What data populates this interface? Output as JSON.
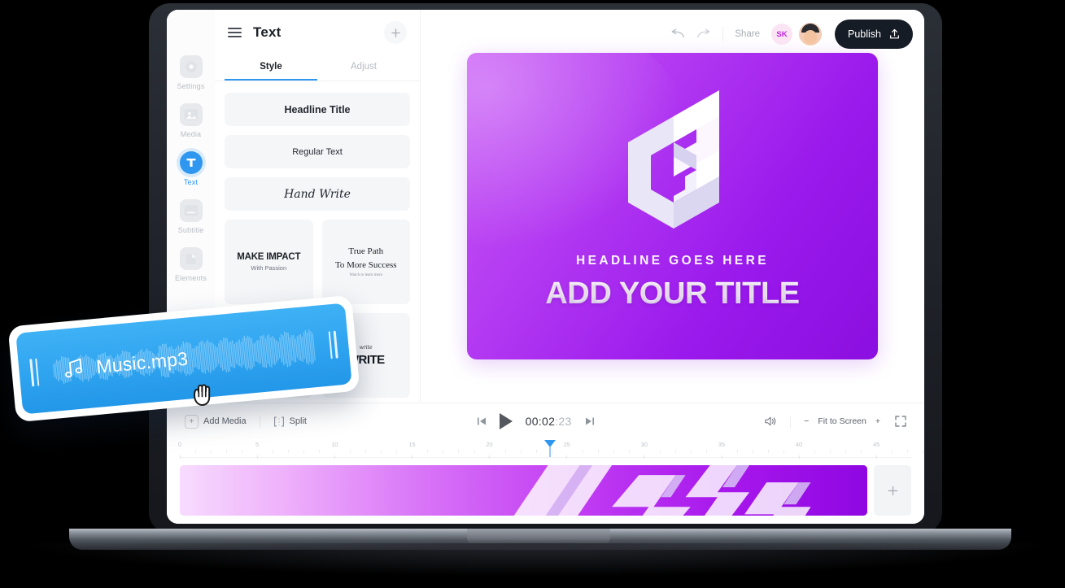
{
  "app": {
    "panel_title": "Text",
    "menu_icon": "hamburger-icon",
    "add_icon": "plus-icon"
  },
  "rail": {
    "items": [
      {
        "label": "Settings",
        "icon": "settings-gear-icon",
        "active": false
      },
      {
        "label": "Media",
        "icon": "image-icon",
        "active": false
      },
      {
        "label": "Text",
        "icon": "text-t-icon",
        "active": true
      },
      {
        "label": "Subtitle",
        "icon": "subtitle-icon",
        "active": false
      },
      {
        "label": "Elements",
        "icon": "elements-shape-icon",
        "active": false
      }
    ]
  },
  "tabs": [
    {
      "label": "Style",
      "active": true
    },
    {
      "label": "Adjust",
      "active": false
    }
  ],
  "presets": {
    "headline": "Headline Title",
    "regular": "Regular Text",
    "handwrite": "Hand Write",
    "card1_title": "MAKE IMPACT",
    "card1_sub": "With Passion",
    "card2_line1": "True Path",
    "card2_line2": "To More Success",
    "card2_sub": "Watch to learn more",
    "card3_small": "write",
    "card3_title": "WRITE"
  },
  "topbar": {
    "undo_icon": "undo-arrow-icon",
    "redo_icon": "redo-arrow-icon",
    "share_label": "Share",
    "avatar_initials": "SK",
    "publish_label": "Publish",
    "publish_icon": "upload-icon",
    "publish_bg": "#161c26"
  },
  "preview": {
    "subtitle": "HEADLINE GOES HERE",
    "title": "ADD YOUR TITLE",
    "logo_icon": "isometric-g-logo",
    "gradient_from": "#c755f5",
    "gradient_to": "#8b0fe0"
  },
  "controls": {
    "add_media": "Add Media",
    "split": "Split",
    "skip_back_icon": "skip-previous-icon",
    "play_icon": "play-icon",
    "skip_forward_icon": "skip-next-icon",
    "timecode_main": "00:02",
    "timecode_frames": ":23",
    "volume_icon": "volume-icon",
    "zoom_out": "−",
    "zoom_label": "Fit to Screen",
    "zoom_in": "+",
    "fullscreen_icon": "fullscreen-icon"
  },
  "timeline": {
    "ticks": [
      "0",
      "5",
      "10",
      "15",
      "20",
      "25",
      "30",
      "35",
      "40",
      "45"
    ],
    "playhead_label": "24",
    "add_clip_icon": "plus-icon",
    "accent": "#2f97f0"
  },
  "music_card": {
    "file_name": "Music.mp3",
    "music_icon": "music-note-icon",
    "cursor_icon": "grab-hand-cursor",
    "color": "#2ea3ef"
  }
}
